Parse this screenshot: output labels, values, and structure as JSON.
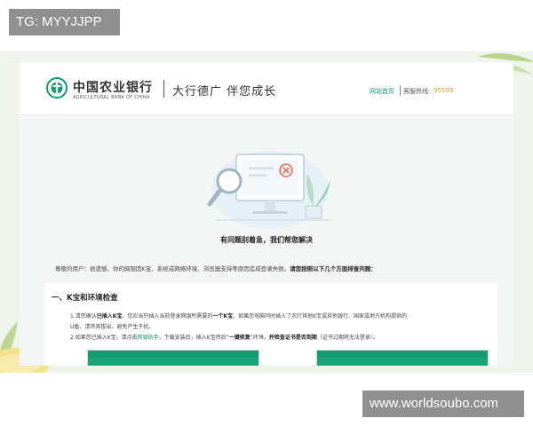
{
  "overlay": {
    "tag": "TG: MYYJJPP",
    "watermark": "www.worldsoubo.com"
  },
  "header": {
    "bank_name_cn": "中国农业银行",
    "bank_name_en": "AGRICULTURAL BANK OF CHINA",
    "slogan": "大行德广  伴您成长",
    "home_link": "网站首页",
    "hotline_label": "客服热线:",
    "hotline_number": "95599"
  },
  "main": {
    "sorry_message": "有问题别着急，我们帮您解决",
    "intro_text": "尊敬的用户：很遗憾，你的网银因K宝、系统或网络环境、浏览器支持等原因造成登录失败。",
    "intro_bold": "请您按照以下几个方面排查问题：",
    "section_title": "一、K宝和环境检查",
    "step1_a": "1.请您确认",
    "step1_b": "已插入K宝",
    "step1_c": "。您应当只插入当前登录网银所需要的",
    "step1_d": "一个K宝",
    "step1_e": "。如果您电脑同时插入了农行其他K宝或其他银行、国家或地方机构提供的",
    "step1_line2": "U盾，请将其拔出，避免产生干扰。",
    "step2_a": "2.如果您已插入K宝，请点击",
    "step2_link": "网银助手",
    "step2_b": "，下载安装后，插入K宝然后“",
    "step2_c": "一键修复",
    "step2_d": "”环境，",
    "step2_e": "并检查证书是否到期",
    "step2_f": "（证书过期将无法登录）。"
  },
  "colors": {
    "brand_green": "#1a9a6e",
    "hotline_gold": "#c9a23b",
    "error_red": "#e05a4a"
  }
}
